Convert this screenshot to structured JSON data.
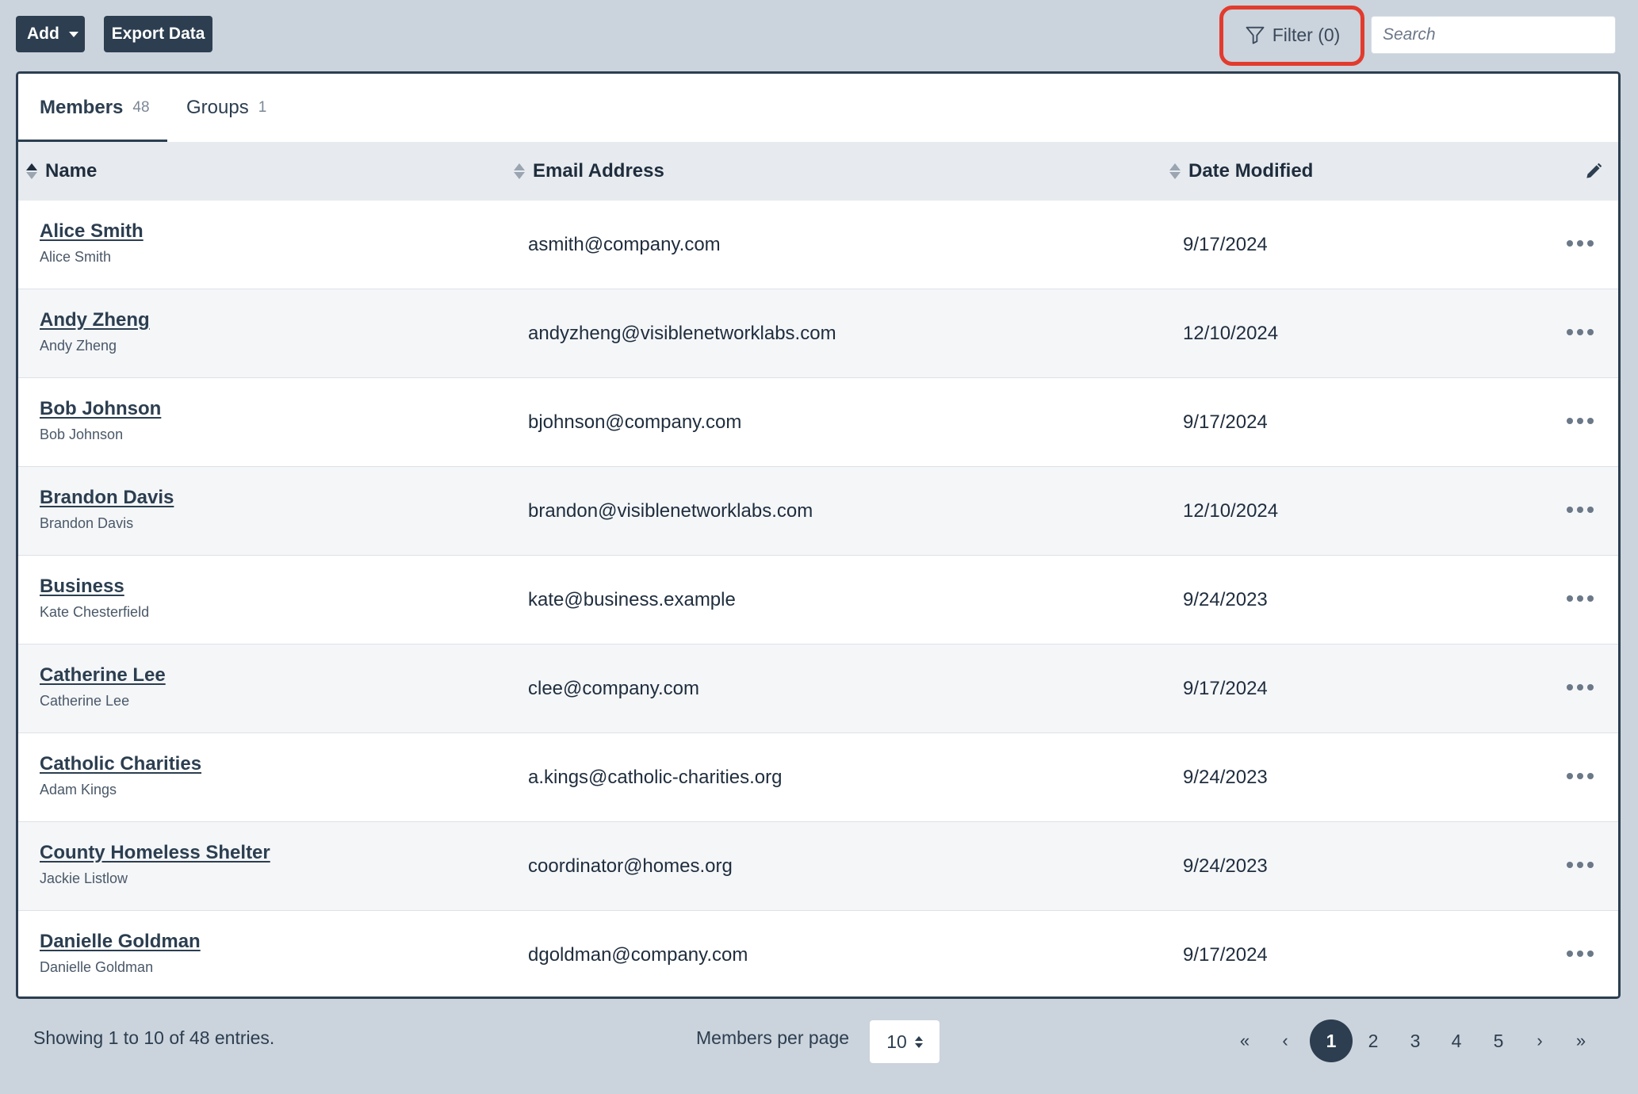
{
  "toolbar": {
    "add_label": "Add",
    "export_label": "Export Data",
    "filter_label": "Filter (0)",
    "search_placeholder": "Search"
  },
  "tabs": [
    {
      "label": "Members",
      "count": "48"
    },
    {
      "label": "Groups",
      "count": "1"
    }
  ],
  "columns": {
    "name": "Name",
    "email": "Email Address",
    "date": "Date Modified"
  },
  "rows": [
    {
      "name": "Alice Smith",
      "sub": "Alice Smith",
      "email": "asmith@company.com",
      "date": "9/17/2024"
    },
    {
      "name": "Andy Zheng",
      "sub": "Andy Zheng",
      "email": "andyzheng@visiblenetworklabs.com",
      "date": "12/10/2024"
    },
    {
      "name": "Bob Johnson",
      "sub": "Bob Johnson",
      "email": "bjohnson@company.com",
      "date": "9/17/2024"
    },
    {
      "name": "Brandon Davis",
      "sub": "Brandon Davis",
      "email": "brandon@visiblenetworklabs.com",
      "date": "12/10/2024"
    },
    {
      "name": "Business",
      "sub": "Kate Chesterfield",
      "email": "kate@business.example",
      "date": "9/24/2023"
    },
    {
      "name": "Catherine Lee",
      "sub": "Catherine Lee",
      "email": "clee@company.com",
      "date": "9/17/2024"
    },
    {
      "name": "Catholic Charities",
      "sub": "Adam Kings",
      "email": "a.kings@catholic-charities.org",
      "date": "9/24/2023"
    },
    {
      "name": "County Homeless Shelter",
      "sub": "Jackie Listlow",
      "email": "coordinator@homes.org",
      "date": "9/24/2023"
    },
    {
      "name": "Danielle Goldman",
      "sub": "Danielle Goldman",
      "email": "dgoldman@company.com",
      "date": "9/17/2024"
    }
  ],
  "footer": {
    "showing": "Showing 1 to 10 of 48 entries.",
    "per_page_label": "Members per page",
    "per_page_value": "10"
  },
  "pagination": {
    "first": "«",
    "prev": "‹",
    "pages": [
      "1",
      "2",
      "3",
      "4",
      "5"
    ],
    "active_page": "1",
    "next": "›",
    "last": "»"
  },
  "colors": {
    "background": "#cbd3dc",
    "primary": "#2c3e50",
    "highlight_ring": "#e23b2e"
  }
}
